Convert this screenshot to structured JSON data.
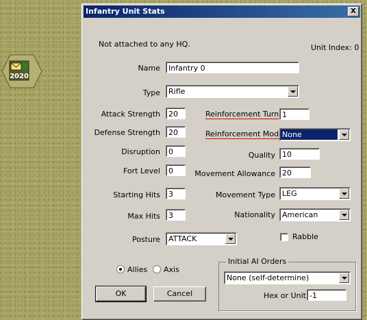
{
  "map": {
    "counter": {
      "year_label": "2020",
      "icon": "envelope-icon",
      "flag_color": "#1f8a1f"
    }
  },
  "dialog": {
    "title": "Infantry Unit Stats",
    "close_label": "X",
    "hq_status": "Not attached to any HQ.",
    "unit_index": "Unit Index: 0",
    "fields": {
      "name": {
        "label": "Name",
        "value": "Infantry 0"
      },
      "type": {
        "label": "Type",
        "value": "Rifle"
      },
      "attack_strength": {
        "label": "Attack Strength",
        "value": "20"
      },
      "defense_strength": {
        "label": "Defense Strength",
        "value": "20"
      },
      "disruption": {
        "label": "Disruption",
        "value": "0"
      },
      "fort_level": {
        "label": "Fort Level",
        "value": "0"
      },
      "starting_hits": {
        "label": "Starting Hits",
        "value": "3"
      },
      "max_hits": {
        "label": "Max Hits",
        "value": "3"
      },
      "posture": {
        "label": "Posture",
        "value": "ATTACK"
      },
      "reinforcement_turn": {
        "label": "Reinforcement Turn",
        "value": "1"
      },
      "reinforcement_mode": {
        "label": "Reinforcement Mode",
        "value": "None"
      },
      "quality": {
        "label": "Quality",
        "value": "10"
      },
      "movement_allowance": {
        "label": "Movement Allowance",
        "value": "20"
      },
      "movement_type": {
        "label": "Movement Type",
        "value": "LEG"
      },
      "nationality": {
        "label": "Nationality",
        "value": "American"
      },
      "rabble": {
        "label": "Rabble",
        "checked": false
      }
    },
    "side": {
      "options": [
        "Allies",
        "Axis"
      ],
      "selected": "Allies"
    },
    "ai_orders": {
      "group_label": "Initial AI Orders",
      "value": "None (self-determine)",
      "hex_label": "Hex or Unit",
      "hex_value": "-1"
    },
    "buttons": {
      "ok": "OK",
      "cancel": "Cancel"
    }
  }
}
